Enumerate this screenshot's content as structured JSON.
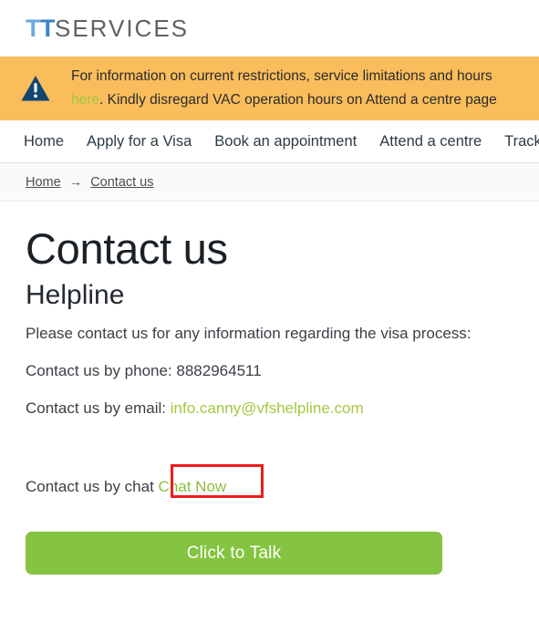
{
  "header": {
    "logo": {
      "tt_first": "T",
      "tt_second": "T",
      "services": "SERVICES",
      "color_first": "#6aa9dd",
      "color_second": "#3d82c4",
      "color_services": "#5d6165"
    }
  },
  "alert": {
    "icon": "warning-triangle-icon",
    "line1_prefix": "For information on current restrictions, service limitations and hours",
    "line2_link": "here",
    "line2_rest": ". Kindly disregard VAC operation hours on Attend a centre page",
    "background": "#f9bd5c",
    "link_color": "#a3c940"
  },
  "nav": {
    "items": [
      {
        "label": "Home"
      },
      {
        "label": "Apply for a Visa"
      },
      {
        "label": "Book an appointment"
      },
      {
        "label": "Attend a centre"
      },
      {
        "label": "Track yo"
      }
    ]
  },
  "breadcrumb": {
    "home": "Home ",
    "separator": "→",
    "current": "Contact us"
  },
  "main": {
    "page_title": "Contact us",
    "section_title": "Helpline",
    "intro": "Please contact us for any information regarding the visa process:",
    "phone_label": "Contact us by phone: 8882964511",
    "email_label": "Contact us by email: ",
    "email_value": "info.canny@vfshelpline.com",
    "chat_label": "Contact us by chat",
    "chat_link": "Chat Now",
    "talk_button": "Click to Talk",
    "accent_green": "#85c440",
    "link_green": "#a3c940",
    "highlight_color": "#ee1c1c"
  }
}
